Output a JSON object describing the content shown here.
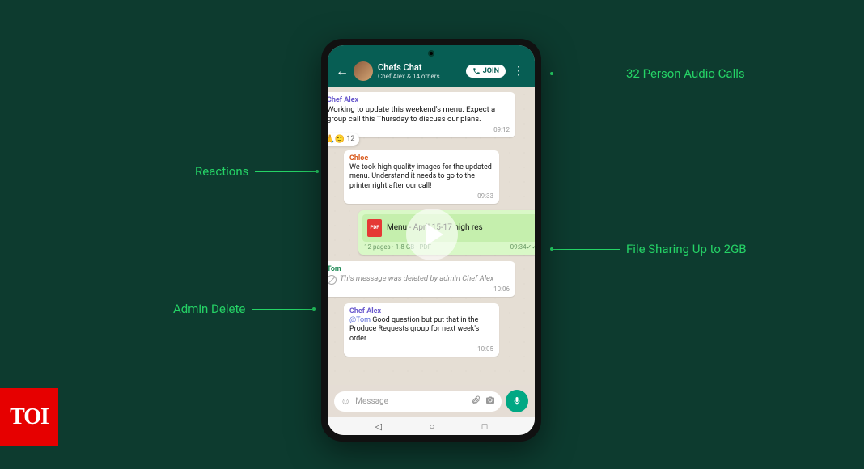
{
  "callouts": {
    "audio_calls": "32 Person Audio Calls",
    "reactions": "Reactions",
    "file_sharing": "File Sharing Up to 2GB",
    "admin_delete": "Admin Delete"
  },
  "header": {
    "title": "Chefs Chat",
    "subtitle": "Chef Alex & 14 others",
    "join_label": "JOIN"
  },
  "messages": {
    "m1": {
      "sender": "Chef Alex",
      "text": "Working to update this weekend's menu. Expect a group call this Thursday to discuss our plans.",
      "time": "09:12",
      "reactions": "👍🙏🙂",
      "reaction_count": "12"
    },
    "m2": {
      "sender": "Chloe",
      "text": "We took high quality images for the updated menu. Understand it needs to go to the printer right after our call!",
      "time": "09:33"
    },
    "file": {
      "icon_label": "PDF",
      "name": "Menu - April 15-17 high res",
      "meta": "12 pages · 1.8 GB · PDF",
      "time": "09:34"
    },
    "m3": {
      "sender": "Tom",
      "text": "This message was deleted by admin Chef Alex",
      "time": "10:06"
    },
    "m4": {
      "sender": "Chef Alex",
      "mention": "@Tom",
      "text": " Good question but put that in the Produce Requests group for next week's order.",
      "time": "10:05"
    }
  },
  "input": {
    "placeholder": "Message"
  },
  "badge": "TOI"
}
